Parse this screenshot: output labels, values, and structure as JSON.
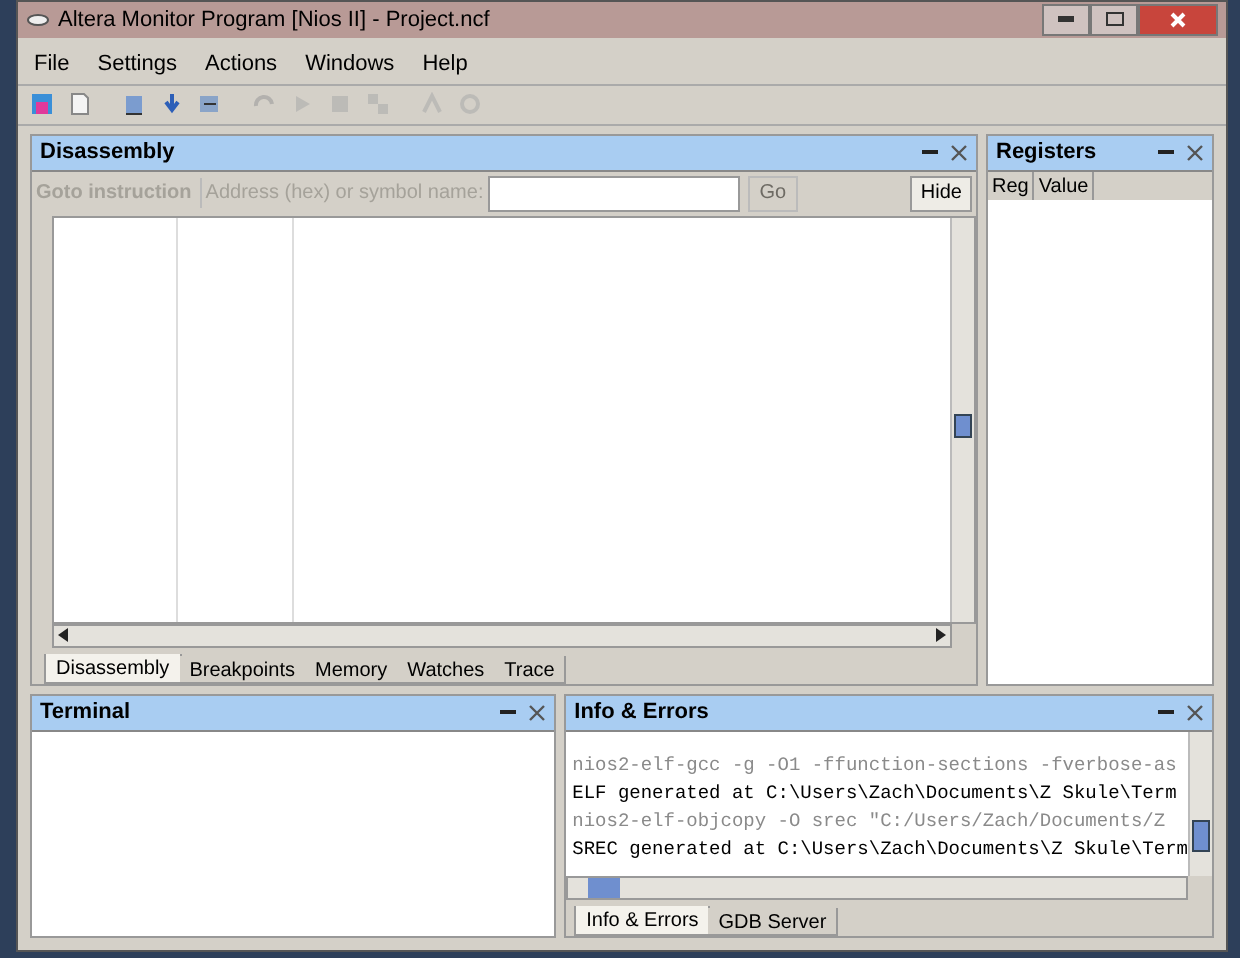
{
  "window": {
    "title": "Altera Monitor Program [Nios II] - Project.ncf"
  },
  "menu": [
    "File",
    "Settings",
    "Actions",
    "Windows",
    "Help"
  ],
  "toolbar": [
    {
      "disabled": false
    },
    {
      "disabled": false
    },
    {
      "disabled": false
    },
    {
      "disabled": false
    },
    {
      "disabled": false
    },
    {
      "disabled": true
    },
    {
      "disabled": true
    },
    {
      "disabled": true
    },
    {
      "disabled": true
    },
    {
      "disabled": true
    },
    {
      "disabled": true
    }
  ],
  "disassembly": {
    "title": "Disassembly",
    "goto_label": "Goto instruction",
    "address_label": "Address (hex) or symbol name:",
    "go_button": "Go",
    "hide_button": "Hide",
    "tabs": [
      {
        "label": "Disassembly",
        "selected": true
      },
      {
        "label": "Breakpoints",
        "selected": false
      },
      {
        "label": "Memory",
        "selected": false
      },
      {
        "label": "Watches",
        "selected": false
      },
      {
        "label": "Trace",
        "selected": false
      }
    ]
  },
  "registers": {
    "title": "Registers",
    "columns": [
      "Reg",
      "Value"
    ]
  },
  "terminal": {
    "title": "Terminal"
  },
  "info": {
    "title": "Info & Errors",
    "lines": [
      {
        "kind": "command",
        "text": "nios2-elf-gcc -g -O1 -ffunction-sections -fverbose-as"
      },
      {
        "kind": "result",
        "text": "ELF generated at C:\\Users\\Zach\\Documents\\Z Skule\\Term"
      },
      {
        "kind": "command",
        "text": "nios2-elf-objcopy -O srec \"C:/Users/Zach/Documents/Z"
      },
      {
        "kind": "result",
        "text": "SREC generated at C:\\Users\\Zach\\Documents\\Z Skule\\Term"
      }
    ],
    "tabs": [
      {
        "label": "Info & Errors",
        "selected": true
      },
      {
        "label": "GDB Server",
        "selected": false
      }
    ]
  }
}
